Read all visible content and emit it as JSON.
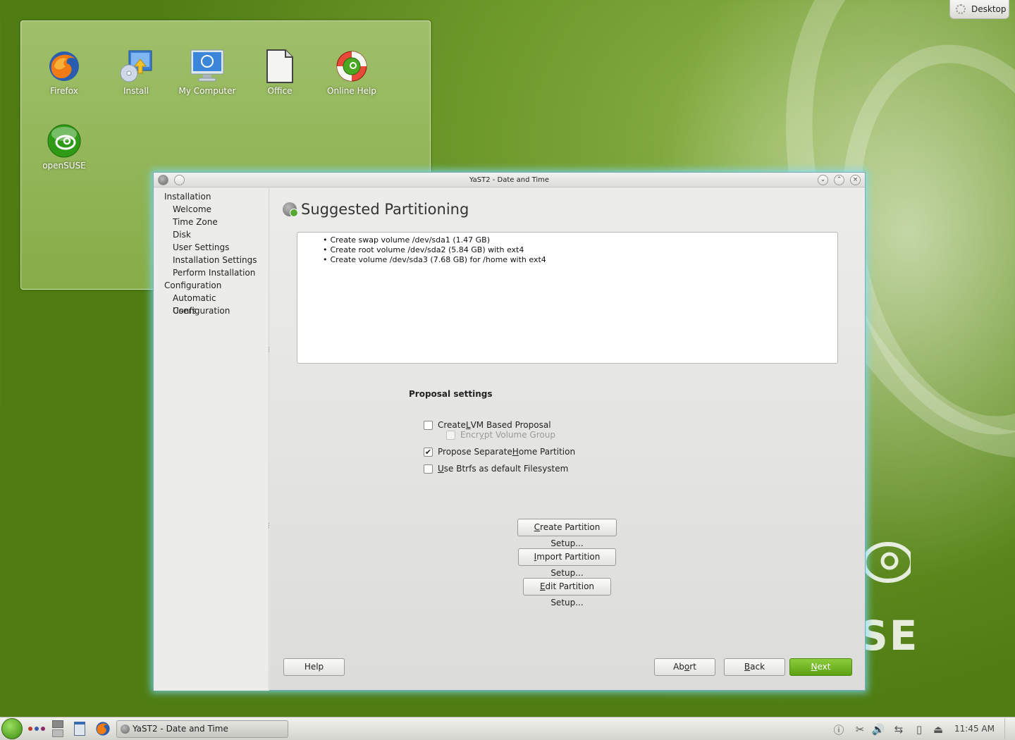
{
  "desktop": {
    "toolbox_label": "Desktop",
    "icons": [
      {
        "label": "Firefox"
      },
      {
        "label": "Install"
      },
      {
        "label": "My Computer"
      },
      {
        "label": "Office"
      },
      {
        "label": "Online Help"
      },
      {
        "label": "openSUSE"
      }
    ]
  },
  "window": {
    "title": "YaST2 - Date and Time",
    "sidebar": {
      "sections": [
        {
          "label": "Installation",
          "steps": [
            "Welcome",
            "Time Zone",
            "Disk",
            "User Settings",
            "Installation Settings",
            "Perform Installation"
          ]
        },
        {
          "label": "Configuration",
          "steps": [
            "Automatic Configuration",
            "Users"
          ]
        }
      ]
    },
    "page_title": "Suggested Partitioning",
    "summary_items": [
      "Create swap volume /dev/sda1 (1.47 GB)",
      "Create root volume /dev/sda2 (5.84 GB) with ext4",
      "Create volume /dev/sda3 (7.68 GB) for /home with ext4"
    ],
    "proposal_settings_label": "Proposal settings",
    "options": {
      "lvm": {
        "pre": "Create ",
        "key": "L",
        "post": "VM Based Proposal",
        "checked": false
      },
      "encrypt": {
        "pre": "Encr",
        "key": "y",
        "post": "pt Volume Group",
        "checked": false,
        "enabled": false
      },
      "home": {
        "pre": "Propose Separate ",
        "key": "H",
        "post": "ome Partition",
        "checked": true
      },
      "btrfs": {
        "pre": "",
        "key": "U",
        "post": "se Btrfs as default Filesystem",
        "checked": false
      }
    },
    "buttons": {
      "create_setup": {
        "key": "C",
        "rest": "reate Partition Setup..."
      },
      "import_setup": {
        "key": "I",
        "rest": "mport Partition Setup..."
      },
      "edit_setup": {
        "key": "E",
        "rest": "dit Partition Setup..."
      },
      "help": "Help",
      "abort": {
        "pre": "Ab",
        "key": "o",
        "post": "rt"
      },
      "back": {
        "pre": "",
        "key": "B",
        "post": "ack"
      },
      "next": {
        "pre": "",
        "key": "N",
        "post": "ext"
      }
    }
  },
  "taskbar": {
    "task_label": "YaST2 - Date and Time",
    "clock": "11:45 AM"
  },
  "colors": {
    "accent_green": "#5aa212",
    "wallpaper_green": "#6f9a2c",
    "window_glow": "#78dcff"
  }
}
